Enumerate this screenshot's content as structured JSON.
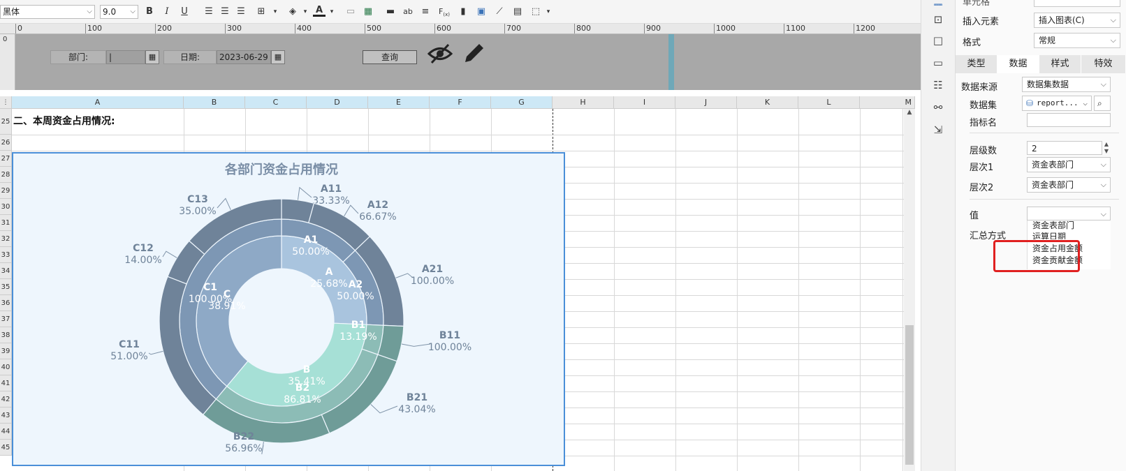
{
  "toolbar": {
    "font_name": "黑体",
    "font_size": "9.0"
  },
  "ruler": {
    "ticks": [
      "0",
      "100",
      "200",
      "300",
      "400",
      "500",
      "600",
      "700",
      "800",
      "900",
      "1000",
      "1100",
      "1200"
    ]
  },
  "params": {
    "dept_label": "部门:",
    "date_label": "日期:",
    "date_value": "2023-06-29",
    "query_label": "查询"
  },
  "sheet": {
    "columns": [
      "A",
      "B",
      "C",
      "D",
      "E",
      "F",
      "G",
      "H",
      "I",
      "J",
      "K",
      "L",
      "M"
    ],
    "rows": [
      "25",
      "26",
      "27",
      "28",
      "29",
      "30",
      "31",
      "32",
      "33",
      "34",
      "35",
      "36",
      "37",
      "38",
      "39",
      "40",
      "41",
      "42",
      "43",
      "44",
      "45"
    ],
    "cell_a25": "二、本周资金占用情况:"
  },
  "chart_data": {
    "type": "pie",
    "title": "各部门资金占用情况",
    "rings": [
      {
        "level": "inner",
        "slices": [
          {
            "name": "A",
            "pct": "25.68%",
            "value": 25.68,
            "color": "#a9c4de"
          },
          {
            "name": "B",
            "pct": "35.41%",
            "value": 35.41,
            "color": "#a6e0d6"
          },
          {
            "name": "C",
            "pct": "38.91%",
            "value": 38.91,
            "color": "#8ea9c6"
          }
        ]
      },
      {
        "level": "middle",
        "slices": [
          {
            "name": "A1",
            "pct": "50.00%",
            "value": 12.84,
            "color": "#7d97b4"
          },
          {
            "name": "A2",
            "pct": "50.00%",
            "value": 12.84,
            "color": "#7d97b4"
          },
          {
            "name": "B1",
            "pct": "13.19%",
            "value": 4.67,
            "color": "#8cbcb6"
          },
          {
            "name": "B2",
            "pct": "86.81%",
            "value": 30.74,
            "color": "#8cbcb6"
          },
          {
            "name": "C1",
            "pct": "100.00%",
            "value": 38.91,
            "color": "#7d97b4"
          }
        ]
      },
      {
        "level": "outer",
        "slices": [
          {
            "name": "A11",
            "pct": "33.33%",
            "value": 4.28,
            "color": "#6f8399"
          },
          {
            "name": "A12",
            "pct": "66.67%",
            "value": 8.56,
            "color": "#6f8399"
          },
          {
            "name": "A21",
            "pct": "100.00%",
            "value": 12.84,
            "color": "#6f8399"
          },
          {
            "name": "B11",
            "pct": "100.00%",
            "value": 4.67,
            "color": "#6f9c98"
          },
          {
            "name": "B21",
            "pct": "43.04%",
            "value": 13.23,
            "color": "#6f9c98"
          },
          {
            "name": "B22",
            "pct": "56.96%",
            "value": 17.51,
            "color": "#6f9c98"
          },
          {
            "name": "C11",
            "pct": "51.00%",
            "value": 19.84,
            "color": "#6f8399"
          },
          {
            "name": "C12",
            "pct": "14.00%",
            "value": 5.45,
            "color": "#6f8399"
          },
          {
            "name": "C13",
            "pct": "35.00%",
            "value": 13.62,
            "color": "#6f8399"
          }
        ]
      }
    ]
  },
  "panel": {
    "cell_label": "单元格",
    "insert_label": "插入元素",
    "insert_value": "插入图表(C)",
    "format_label": "格式",
    "format_value": "常规",
    "tabs": [
      "类型",
      "数据",
      "样式",
      "特效"
    ],
    "source_label": "数据来源",
    "source_value": "数据集数据",
    "dataset_label": "数据集",
    "dataset_value": "report...",
    "metric_label": "指标名",
    "levels_label": "层级数",
    "levels_value": "2",
    "level1_label": "层次1",
    "level1_value": "资金表部门",
    "level2_label": "层次2",
    "level2_value": "资金表部门",
    "value_label": "值",
    "summary_label": "汇总方式",
    "options": [
      "资金表部门",
      "运算日期",
      "资金占用金额",
      "资金贡献金额"
    ]
  },
  "colors": {
    "highlight": "#e02020",
    "selection": "#4a8fd8"
  }
}
